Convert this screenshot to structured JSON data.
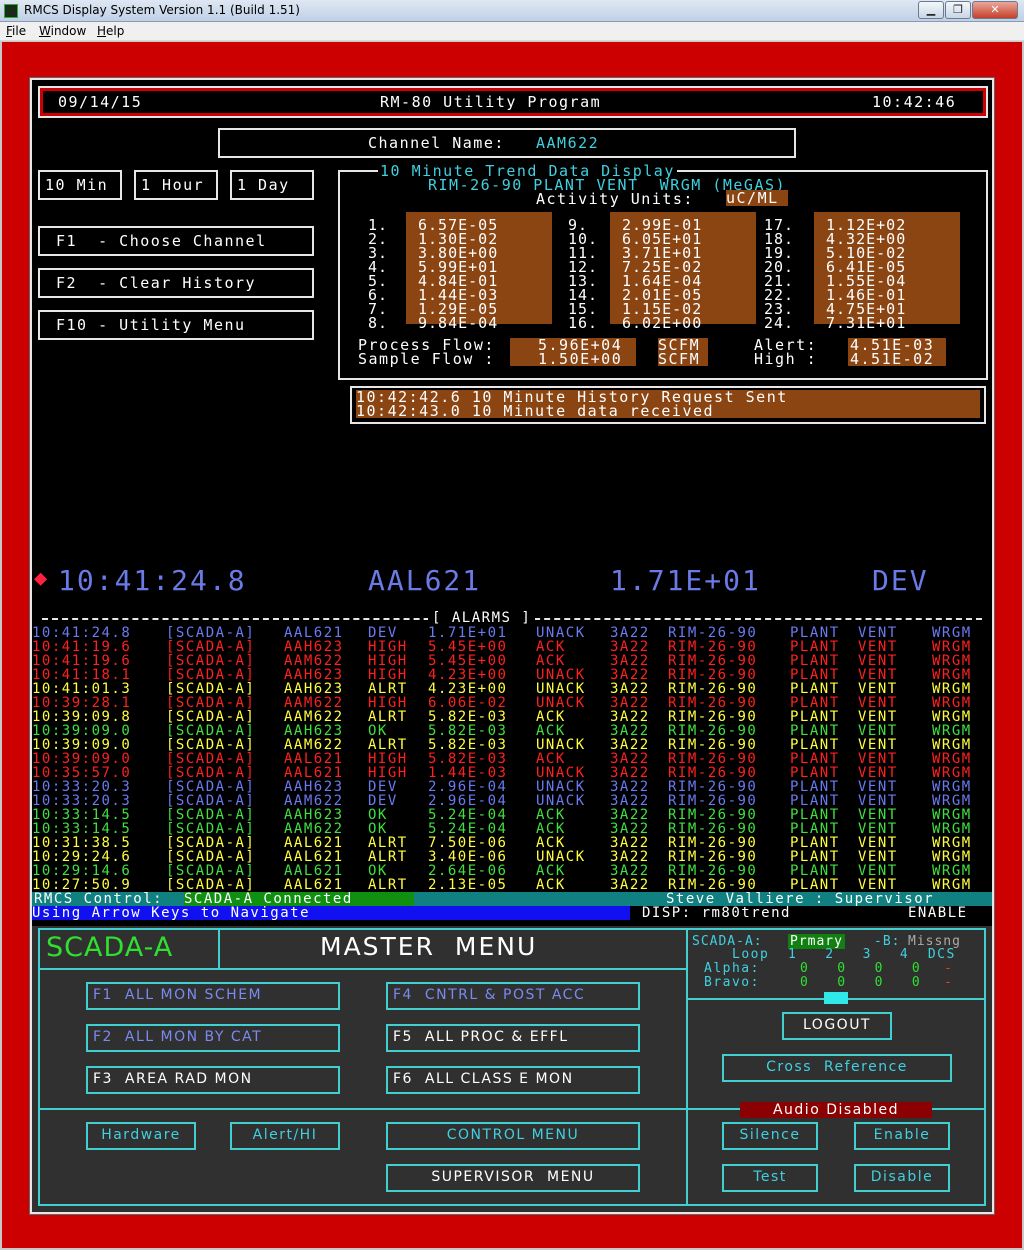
{
  "window": {
    "title": "RMCS Display System    Version 1.1   (Build 1.51)",
    "min": "▁",
    "max": "❐",
    "close": "✕"
  },
  "menu": [
    "File",
    "Window",
    "Help"
  ],
  "header": {
    "date": "09/14/15",
    "program": "RM-80 Utility Program",
    "time": "10:42:46"
  },
  "channel": {
    "label": "Channel Name:",
    "value": "AAM622"
  },
  "range_buttons": [
    "10 Min",
    "1 Hour",
    "1 Day"
  ],
  "fkeys": [
    "F1  - Choose Channel",
    "F2  - Clear History",
    "F10 - Utility Menu"
  ],
  "trend": {
    "title": "10 Minute Trend Data Display",
    "subtitle": "RIM-26-90 PLANT VENT  WRGM (MeGAS)",
    "units_label": "Activity Units:",
    "units": "uC/ML",
    "col1": {
      "nums": "1.\n2.\n3.\n4.\n5.\n6.\n7.\n8.",
      "vals": "6.57E-05\n1.30E-02\n3.80E+00\n5.99E+01\n4.84E-01\n1.44E-03\n1.29E-05\n9.84E-04"
    },
    "col2": {
      "nums": "9.\n10.\n11.\n12.\n13.\n14.\n15.\n16.",
      "vals": "2.99E-01\n6.05E+01\n3.71E+01\n7.25E-02\n1.64E-04\n2.01E-05\n1.15E-02\n6.02E+00"
    },
    "col3": {
      "nums": "17.\n18.\n19.\n20.\n21.\n22.\n23.\n24.",
      "vals": "1.12E+02\n4.32E+00\n5.10E-02\n6.41E-05\n1.55E-04\n1.46E-01\n4.75E+01\n7.31E+01"
    },
    "process_flow_label": "Process Flow:",
    "process_flow": "5.96E+04",
    "pf_unit": "SCFM",
    "sample_flow_label": "Sample Flow :",
    "sample_flow": "1.50E+00",
    "sf_unit": "SCFM",
    "alert_label": "Alert:",
    "alert": "4.51E-03",
    "high_label": "High :",
    "high": "4.51E-02"
  },
  "messages": [
    "10:42:42.6 10 Minute History Request Sent",
    "10:42:43.0 10 Minute data received"
  ],
  "current": {
    "diamond": "◆",
    "time": "10:41:24.8",
    "channel": "AAL621",
    "value": "1.71E+01",
    "state": "DEV"
  },
  "alarms_title": "[ ALARMS ]",
  "alarms": [
    {
      "t": "10:41:24.8",
      "src": "[SCADA-A]",
      "ch": "AAL621",
      "st": "DEV",
      "v": "1.71E+01",
      "ack": "UNACK",
      "c": "#6a7af0"
    },
    {
      "t": "10:41:19.6",
      "src": "[SCADA-A]",
      "ch": "AAH623",
      "st": "HIGH",
      "v": "5.45E+00",
      "ack": "ACK",
      "c": "#ff2020"
    },
    {
      "t": "10:41:19.6",
      "src": "[SCADA-A]",
      "ch": "AAM622",
      "st": "HIGH",
      "v": "5.45E+00",
      "ack": "ACK",
      "c": "#ff2020"
    },
    {
      "t": "10:41:18.1",
      "src": "[SCADA-A]",
      "ch": "AAH623",
      "st": "HIGH",
      "v": "4.23E+00",
      "ack": "UNACK",
      "c": "#ff2020"
    },
    {
      "t": "10:41:01.3",
      "src": "[SCADA-A]",
      "ch": "AAH623",
      "st": "ALRT",
      "v": "4.23E+00",
      "ack": "UNACK",
      "c": "#ffff40"
    },
    {
      "t": "10:39:28.1",
      "src": "[SCADA-A]",
      "ch": "AAM622",
      "st": "HIGH",
      "v": "6.06E-02",
      "ack": "UNACK",
      "c": "#ff2020"
    },
    {
      "t": "10:39:09.8",
      "src": "[SCADA-A]",
      "ch": "AAM622",
      "st": "ALRT",
      "v": "5.82E-03",
      "ack": "ACK",
      "c": "#ffff40"
    },
    {
      "t": "10:39:09.0",
      "src": "[SCADA-A]",
      "ch": "AAH623",
      "st": "OK",
      "v": "5.82E-03",
      "ack": "ACK",
      "c": "#40e040"
    },
    {
      "t": "10:39:09.0",
      "src": "[SCADA-A]",
      "ch": "AAM622",
      "st": "ALRT",
      "v": "5.82E-03",
      "ack": "UNACK",
      "c": "#ffff40"
    },
    {
      "t": "10:39:09.0",
      "src": "[SCADA-A]",
      "ch": "AAL621",
      "st": "HIGH",
      "v": "5.82E-03",
      "ack": "ACK",
      "c": "#ff2020"
    },
    {
      "t": "10:35:57.0",
      "src": "[SCADA-A]",
      "ch": "AAL621",
      "st": "HIGH",
      "v": "1.44E-03",
      "ack": "UNACK",
      "c": "#ff2020"
    },
    {
      "t": "10:33:20.3",
      "src": "[SCADA-A]",
      "ch": "AAH623",
      "st": "DEV",
      "v": "2.96E-04",
      "ack": "UNACK",
      "c": "#6a7af0"
    },
    {
      "t": "10:33:20.3",
      "src": "[SCADA-A]",
      "ch": "AAM622",
      "st": "DEV",
      "v": "2.96E-04",
      "ack": "UNACK",
      "c": "#6a7af0"
    },
    {
      "t": "10:33:14.5",
      "src": "[SCADA-A]",
      "ch": "AAH623",
      "st": "OK",
      "v": "5.24E-04",
      "ack": "ACK",
      "c": "#40e040"
    },
    {
      "t": "10:33:14.5",
      "src": "[SCADA-A]",
      "ch": "AAM622",
      "st": "OK",
      "v": "5.24E-04",
      "ack": "ACK",
      "c": "#40e040"
    },
    {
      "t": "10:31:38.5",
      "src": "[SCADA-A]",
      "ch": "AAL621",
      "st": "ALRT",
      "v": "7.50E-06",
      "ack": "ACK",
      "c": "#ffff40"
    },
    {
      "t": "10:29:24.6",
      "src": "[SCADA-A]",
      "ch": "AAL621",
      "st": "ALRT",
      "v": "3.40E-06",
      "ack": "UNACK",
      "c": "#ffff40"
    },
    {
      "t": "10:29:14.6",
      "src": "[SCADA-A]",
      "ch": "AAL621",
      "st": "OK",
      "v": "2.64E-06",
      "ack": "ACK",
      "c": "#40e040"
    },
    {
      "t": "10:27:50.9",
      "src": "[SCADA-A]",
      "ch": "AAL621",
      "st": "ALRT",
      "v": "2.13E-05",
      "ack": "ACK",
      "c": "#ffff40"
    }
  ],
  "alarm_tail": {
    "code": "3A22",
    "loc": "RIM-26-90",
    "w1": "PLANT",
    "w2": "VENT",
    "w3": "WRGM"
  },
  "status": {
    "control_label": "RMCS Control:",
    "control_value": "SCADA-A Connected",
    "user": "Steve Valliere : Supervisor",
    "nav": "Using Arrow Keys to Navigate",
    "disp": "DISP: rm80trend",
    "enable": "ENABLE"
  },
  "master": {
    "scada": "SCADA-A",
    "title": "MASTER  MENU",
    "b_f1": "F1  ALL MON SCHEM",
    "b_f2": "F2  ALL MON BY CAT",
    "b_f3": "F3  AREA RAD MON",
    "b_f4": "F4  CNTRL & POST ACC",
    "b_f5": "F5  ALL PROC & EFFL",
    "b_f6": "F6  ALL CLASS E MON",
    "hardware": "Hardware",
    "alerthi": "Alert/HI",
    "control": "CONTROL MENU",
    "supervisor": "SUPERVISOR  MENU",
    "logout": "LOGOUT",
    "cross": "Cross  Reference",
    "audio": "Audio Disabled",
    "silence": "Silence",
    "enable": "Enable",
    "test": "Test",
    "disable": "Disable",
    "loop_a": "SCADA-A:",
    "loop_a_v": "Prmary",
    "loop_b": "-B:",
    "loop_b_v": "Missng",
    "loop_hdr": "Loop  1   2   3   4  DCS",
    "alpha": "Alpha:",
    "bravo": "Bravo:",
    "alpha_v": "0   0   0   0",
    "bravo_v": "0   0   0   0",
    "dash": "-"
  }
}
